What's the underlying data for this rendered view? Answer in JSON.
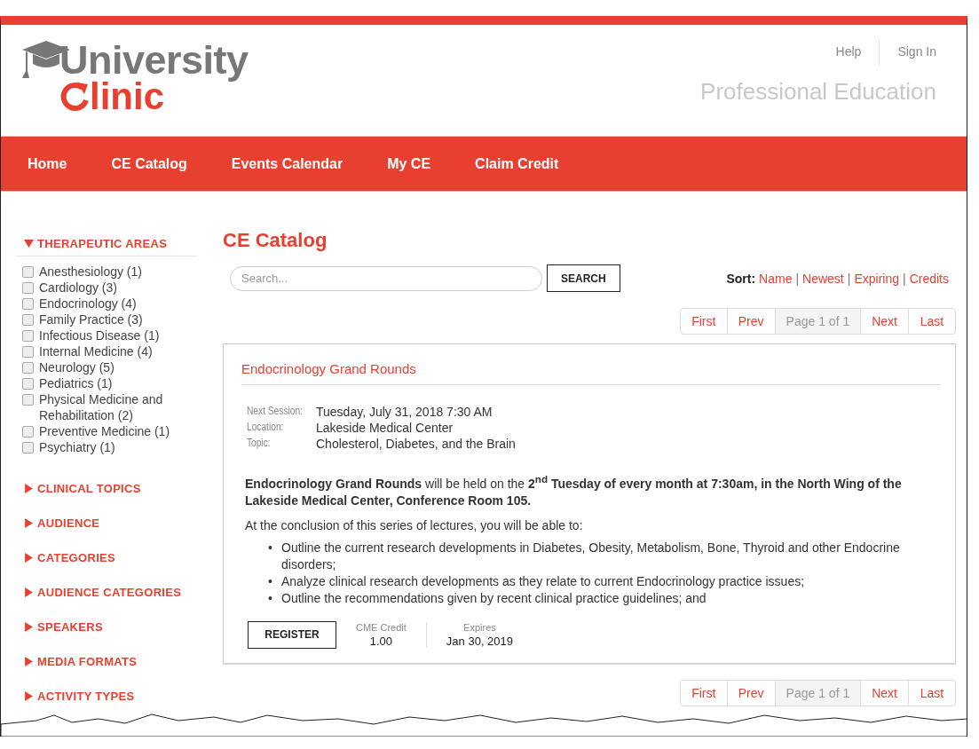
{
  "logo": {
    "line1": "University",
    "line2": "linic"
  },
  "header_links": [
    "Help",
    "Sign In"
  ],
  "tagline": "Professional Education",
  "nav": [
    "Home",
    "CE Catalog",
    "Events Calendar",
    "My CE",
    "Claim Credit"
  ],
  "filters": [
    {
      "title": "THERAPEUTIC AREAS",
      "expanded": true,
      "items": [
        {
          "label": "Anesthesiology (1)",
          "checked": false
        },
        {
          "label": "Cardiology (3)",
          "checked": false
        },
        {
          "label": "Endocrinology (4)",
          "checked": false
        },
        {
          "label": "Family Practice (3)",
          "checked": false
        },
        {
          "label": "Infectious Disease (1)",
          "checked": false
        },
        {
          "label": "Internal Medicine (4)",
          "checked": false
        },
        {
          "label": "Neurology (5)",
          "checked": false
        },
        {
          "label": "Pediatrics (1)",
          "checked": false
        },
        {
          "label": "Physical Medicine and Rehabilitation (2)",
          "checked": false
        },
        {
          "label": "Preventive Medicine (1)",
          "checked": false
        },
        {
          "label": "Psychiatry (1)",
          "checked": false
        }
      ]
    },
    {
      "title": "CLINICAL TOPICS",
      "expanded": false
    },
    {
      "title": "AUDIENCE",
      "expanded": false
    },
    {
      "title": "CATEGORIES",
      "expanded": false
    },
    {
      "title": "AUDIENCE CATEGORIES",
      "expanded": false
    },
    {
      "title": "SPEAKERS",
      "expanded": false
    },
    {
      "title": "MEDIA FORMATS",
      "expanded": false
    },
    {
      "title": "ACTIVITY TYPES",
      "expanded": false
    }
  ],
  "page_title": "CE Catalog",
  "search": {
    "placeholder": "Search...",
    "button": "SEARCH"
  },
  "sort": {
    "label": "Sort:",
    "separator": "|",
    "options": [
      "Name",
      "Newest",
      "Expiring",
      "Credits"
    ]
  },
  "pagination_top": [
    {
      "label": "First",
      "kind": "link"
    },
    {
      "label": "Prev",
      "kind": "link"
    },
    {
      "label": "Page 1 of 1",
      "kind": "current"
    },
    {
      "label": "Next",
      "kind": "link"
    },
    {
      "label": "Last",
      "kind": "link"
    }
  ],
  "activity": {
    "title": "Endocrinology Grand Rounds",
    "details": [
      {
        "label": "Next Session:",
        "value": "Tuesday, July 31, 2018 7:30 AM"
      },
      {
        "label": "Location:",
        "value": "Lakeside Medical Center"
      },
      {
        "label": "Topic:",
        "value": "Cholesterol, Diabetes, and the Brain"
      }
    ],
    "description": "**Endocrinology Grand Rounds** will be held on the **2$^{nd}$ Tuesday of every month at 7:30am, in the North Wing of the Lakeside Medical Center, Conference Room 105.**",
    "bullet": "•",
    "intro": "At the conclusion of this series of lectures, you will be able to:",
    "objectives": [
      "Outline the current research developments in Diabetes, Obesity, Metabolism, Bone, Thyroid and other Endocrine disorders;",
      "Analyze clinical research developments as they relate to current Endocrinology practice issues;",
      "Outline the recommendations given by recent clinical practice guidelines; and"
    ],
    "button": "REGISTER",
    "credit_label": "CME Credit",
    "credit": "1.00",
    "expires_label": "Expires",
    "expires": "Jan 30, 2019"
  },
  "pagination_bottom": [
    {
      "label": "First",
      "kind": "link"
    },
    {
      "label": "Prev",
      "kind": "link"
    },
    {
      "label": "Page 1 of 1",
      "kind": "current"
    },
    {
      "label": "Next",
      "kind": "link"
    },
    {
      "label": "Last",
      "kind": "link"
    }
  ]
}
